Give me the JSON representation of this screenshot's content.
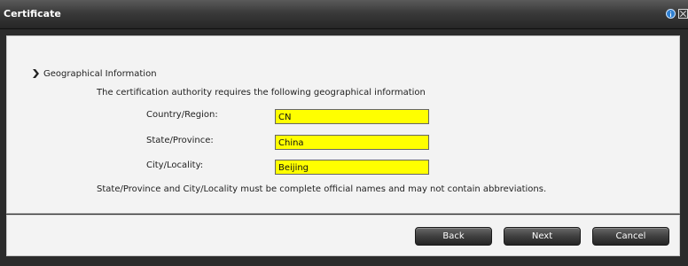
{
  "window": {
    "title": "Certificate"
  },
  "section": {
    "title": "Geographical Information",
    "description": "The certification authority requires the following geographical information",
    "note": "State/Province and City/Locality must be complete official names and may not contain abbreviations."
  },
  "fields": {
    "country": {
      "label": "Country/Region:",
      "value": "CN"
    },
    "state": {
      "label": "State/Province:",
      "value": "China"
    },
    "city": {
      "label": "City/Locality:",
      "value": "Beijing"
    }
  },
  "buttons": {
    "back": "Back",
    "next": "Next",
    "cancel": "Cancel"
  },
  "colors": {
    "field_highlight": "#ffff00",
    "titlebar": "#333333",
    "panel": "#f3f3f3"
  },
  "icons": {
    "info": "info-icon",
    "close": "close-icon",
    "section": "chevron-right-icon"
  }
}
